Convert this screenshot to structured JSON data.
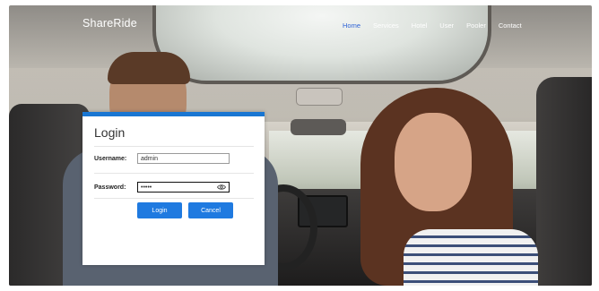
{
  "header": {
    "brand": "ShareRide",
    "nav": [
      {
        "label": "Home",
        "active": true
      },
      {
        "label": "Services"
      },
      {
        "label": "Hotel"
      },
      {
        "label": "User"
      },
      {
        "label": "Pooler"
      },
      {
        "label": "Contact"
      }
    ]
  },
  "login": {
    "title": "Login",
    "username_label": "Username:",
    "username_value": "admin",
    "password_label": "Password:",
    "password_value": "•••••",
    "login_button": "Login",
    "cancel_button": "Cancel"
  },
  "colors": {
    "accent": "#1976d2",
    "button": "#1f7ae0",
    "active_nav": "#2e63d6"
  },
  "icons": [
    "eye-icon"
  ]
}
